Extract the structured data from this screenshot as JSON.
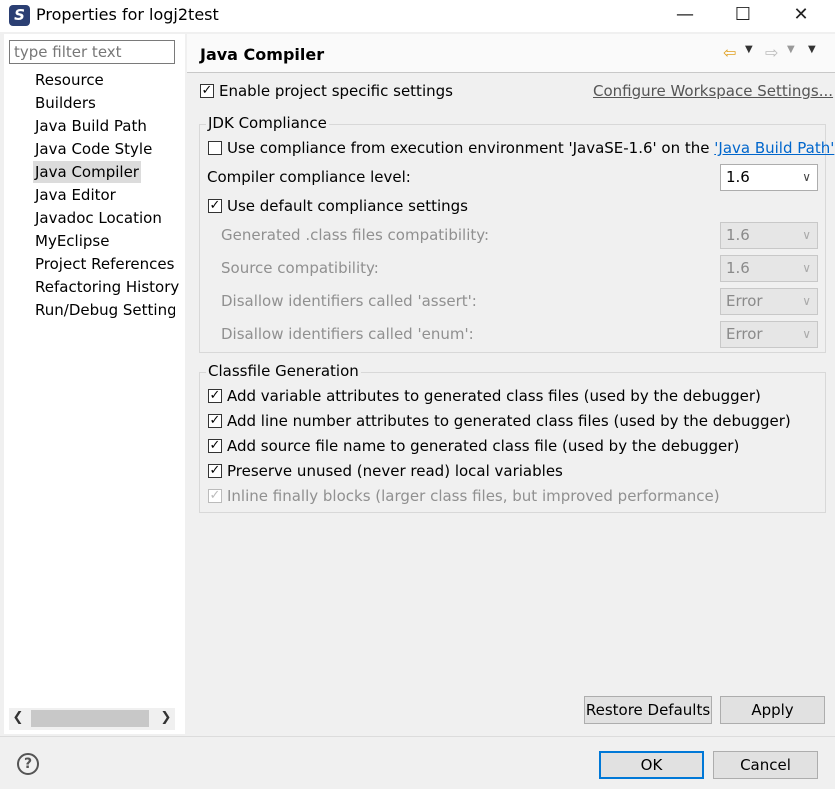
{
  "window": {
    "title": "Properties for logj2test",
    "minimize": "—",
    "maximize": "☐",
    "close": "✕"
  },
  "sidebar": {
    "filter_placeholder": "type filter text",
    "items": [
      {
        "label": "Resource"
      },
      {
        "label": "Builders"
      },
      {
        "label": "Java Build Path"
      },
      {
        "label": "Java Code Style"
      },
      {
        "label": "Java Compiler"
      },
      {
        "label": "Java Editor"
      },
      {
        "label": "Javadoc Location"
      },
      {
        "label": "MyEclipse"
      },
      {
        "label": "Project References"
      },
      {
        "label": "Refactoring History"
      },
      {
        "label": "Run/Debug Settings"
      }
    ],
    "selected_index": 4
  },
  "page": {
    "title": "Java Compiler",
    "enable_project_settings": "Enable project specific settings",
    "configure_workspace": "Configure Workspace Settings...",
    "jdk": {
      "group_title": "JDK Compliance",
      "use_env": "Use compliance from execution environment 'JavaSE-1.6' on the ",
      "build_path_link": "'Java Build Path'",
      "compliance_level_label": "Compiler compliance level:",
      "compliance_level_value": "1.6",
      "use_default": "Use default compliance settings",
      "generated_label": "Generated .class files compatibility:",
      "generated_value": "1.6",
      "source_label": "Source compatibility:",
      "source_value": "1.6",
      "assert_label": "Disallow identifiers called 'assert':",
      "assert_value": "Error",
      "enum_label": "Disallow identifiers called 'enum':",
      "enum_value": "Error"
    },
    "classfile": {
      "group_title": "Classfile Generation",
      "var_attrs": "Add variable attributes to generated class files (used by the debugger)",
      "line_attrs": "Add line number attributes to generated class files (used by the debugger)",
      "source_name": "Add source file name to generated class file (used by the debugger)",
      "preserve_unused": "Preserve unused (never read) local variables",
      "inline_finally": "Inline finally blocks (larger class files, but improved performance)"
    }
  },
  "buttons": {
    "restore_defaults": "Restore Defaults",
    "apply": "Apply",
    "ok": "OK",
    "cancel": "Cancel",
    "help": "?"
  },
  "icons": {
    "app": "myeclipse-icon",
    "back": "back-arrow-icon",
    "forward": "forward-arrow-icon",
    "menu": "chevron-down-icon"
  },
  "colors": {
    "link": "#0066cc",
    "default_button_border": "#0078d7",
    "dialog_bg": "#f0f0f0"
  }
}
